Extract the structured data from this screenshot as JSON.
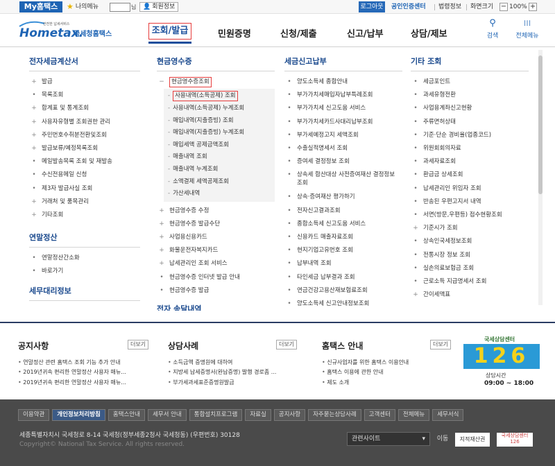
{
  "topbar": {
    "my_hometax": "My홈택스",
    "my_menu": "나의메뉴",
    "name_suffix": "님",
    "member_info": "회원정보",
    "logout": "로그아웃",
    "cert_center": "공인인증센터",
    "law_info": "법령정보",
    "screen_size": "화면크기",
    "zoom": "100%"
  },
  "header": {
    "logo_small": "안전한 납세서비스",
    "logo_main": "Hometax.",
    "logo_kr": "국세청홈택스",
    "nav": [
      "조회/발급",
      "민원증명",
      "신청/제출",
      "신고/납부",
      "상담/제보"
    ],
    "search": "검색",
    "all_menu": "전체메뉴"
  },
  "menu": {
    "col1": {
      "title": "전자세금계산서",
      "items": [
        "발급",
        "목록조회",
        "합계표 및 통계조회",
        "사용자유형별 조회권한 관리",
        "주민번호수취분전환및조회",
        "발급보류/예정목록조회",
        "메일발송목록 조회 및 재발송",
        "수신전용메일 신청",
        "제3자 발급사실 조회",
        "거래처 및 품목관리",
        "기타조회"
      ],
      "title2": "연말정산",
      "items2": [
        "연말정산간소화",
        "바로가기"
      ],
      "title3": "세무대리정보"
    },
    "col2": {
      "title": "현금영수증",
      "section": "현금영수증조회",
      "sub": [
        "사용내역(소득공제) 조회",
        "사용내역(소득공제) 누계조회",
        "매입내역(지출증빙) 조회",
        "매입내역(지출증빙) 누계조회",
        "매입세액 공제금액조회",
        "매출내역 조회",
        "매출내역 누계조회",
        "소액결제 세액공제조회",
        "가산세내역"
      ],
      "items": [
        "현금영수증 수정",
        "현금영수증 발급수단",
        "사업용신용카드",
        "화물운전자복지카드",
        "납세관리인 조회 서비스",
        "현금영수증 인터넷 발급 안내",
        "현금영수증 발급"
      ],
      "title2": "전자 송달내역"
    },
    "col3": {
      "title": "세금신고납부",
      "items": [
        "양도소득세 종합안내",
        "부가가치세매입자납부특례조회",
        "부가가치세 신고도움 서비스",
        "부가가치세카드사대리납부조회",
        "부가세예정고지 세액조회",
        "수출실적명세서 조회",
        "증여세 결정정보 조회",
        "상속세 합산대상 사전증여재산 결정정보 조회",
        "상속·증여재산 평가하기",
        "전자신고결과조회",
        "종합소득세 신고도움 서비스",
        "신용카드 매출자료조회",
        "현지기업고유번호 조회",
        "납부내역 조회",
        "타인세금 납부결과 조회",
        "연금건강고용산재보험료조회",
        "양도소득세 신고안내정보조회"
      ]
    },
    "col4": {
      "title": "기타 조회",
      "items": [
        "세금포인트",
        "과세유형전환",
        "사업용계좌신고현황",
        "주류면허상태",
        "기준·단순 경비율(업종코드)",
        "위원회회의자료",
        "과세자료조회",
        "환급금 상세조회",
        "납세관리인 위임자 조회",
        "반송된 우편고지서 내역",
        "서면(방문,우편등) 접수현황조회",
        "기준시가 조회",
        "상속인국세정보조회",
        "전통시장 정보 조회",
        "실손의료보험금 조회",
        "근로소득 지급명세서 조회",
        "간이세액표"
      ]
    }
  },
  "notice": {
    "title": "공지사항",
    "items": [
      "연말정산 관련 홈택스 조회 기능 추가 안내",
      "2019년귀속 편리한 연말정산 사용자 매뉴...",
      "2019년귀속 편리한 연말정산 사용자 매뉴..."
    ],
    "more": "더보기"
  },
  "cases": {
    "title": "상담사례",
    "items": [
      "소득금액 증명원에 대하여",
      "지방세 납세증명서(완납증명) 발행 경로좀 ...",
      "부가세과세표준증명원발급"
    ],
    "more": "더보기"
  },
  "guide": {
    "title": "홈택스 안내",
    "items": [
      "신규사업자를 위한 홈택스 이용안내",
      "홈택스 이용에 관한 안내",
      "제도 소개"
    ],
    "more": "더보기"
  },
  "call_center": {
    "label": "국세상담센터",
    "number": "126",
    "hours_label": "상담시간",
    "hours": "09:00 ~ 18:00"
  },
  "footer": {
    "links": [
      "이용약관",
      "개인정보처리방침",
      "홈택스안내",
      "세무서 안내",
      "통합설치프로그램",
      "자료실",
      "공지사항",
      "자주묻는상담사례",
      "고객센터",
      "전체메뉴",
      "세무서식"
    ],
    "address": "세종특별자치시 국세청로 8-14 국세청(정부세종2청사 국세청동) (우편번호) 30128",
    "copyright": "Copyright© National Tax Service. All rights reserved.",
    "site_select": "관련사이트",
    "go": "이동",
    "badge1": "지적재산권",
    "badge2": "국세상담센터 126"
  },
  "colors": {
    "primary": "#1e64b4",
    "accent_red": "#e63c3c",
    "footer_bg": "#4a4a4a"
  }
}
